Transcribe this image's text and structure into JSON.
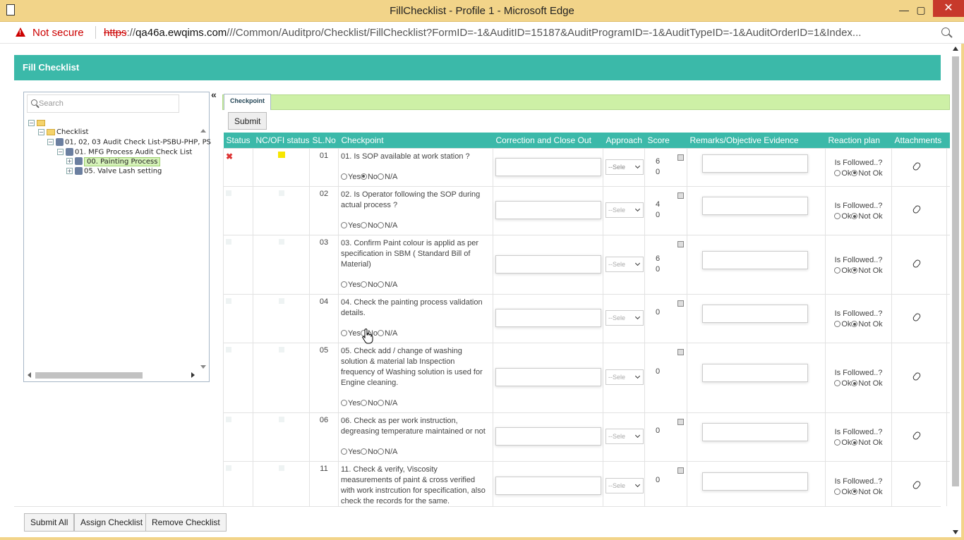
{
  "window": {
    "title": "FillChecklist - Profile 1 - Microsoft Edge"
  },
  "address": {
    "security": "Not secure",
    "scheme": "https",
    "host": "qa46a.ewqims.com",
    "path": "///Common/Auditpro/Checklist/FillChecklist?FormID=-1&AuditID=15187&AuditProgramID=-1&AuditTypeID=-1&AuditOrderID=1&Index..."
  },
  "page": {
    "header": "Fill Checklist",
    "search_placeholder": "Search",
    "collapse_glyph": "«"
  },
  "tree": {
    "root": "Checklist",
    "level1": "01, 02, 03 Audit Check List-PSBU-PHP, PS",
    "level2": "01. MFG Process Audit Check List",
    "level3a": "00. Painting Process",
    "level3b": "05. Valve Lash setting"
  },
  "tabs": {
    "checkpoint": "Checkpoint"
  },
  "toolbar": {
    "submit": "Submit"
  },
  "columns": {
    "status": "Status",
    "ncofi": "NC/OFI status",
    "slno": "SL.No",
    "checkpoint": "Checkpoint",
    "correction": "Correction and Close Out",
    "approach": "Approach",
    "score": "Score",
    "remarks": "Remarks/Objective Evidence",
    "reaction": "Reaction plan",
    "attachments": "Attachments"
  },
  "labels": {
    "yes": "Yes",
    "no": "No",
    "na": "N/A",
    "select": "--Sele",
    "followed": "Is Followed..?",
    "ok": "Ok",
    "notok": "Not Ok",
    "status_x": "✖"
  },
  "rows": [
    {
      "sl": "01",
      "text": "01. Is SOP available at work station ?",
      "score1": "6",
      "score2": "0",
      "answer": "No"
    },
    {
      "sl": "02",
      "text": "02. Is Operator following the SOP during actual process ?",
      "score1": "4",
      "score2": "0",
      "answer": ""
    },
    {
      "sl": "03",
      "text": "03. Confirm Paint colour is applid as per specification in SBM ( Standard Bill of Material)",
      "score1": "6",
      "score2": "0",
      "answer": ""
    },
    {
      "sl": "04",
      "text": "04. Check the painting process validation details.",
      "score1": "0",
      "score2": "",
      "answer": ""
    },
    {
      "sl": "05",
      "text": "05. Check add / change of washing solution & material lab Inspection frequency of Washing solution is used for Engine cleaning.",
      "score1": "0",
      "score2": "",
      "answer": ""
    },
    {
      "sl": "06",
      "text": "06. Check as per work instruction, degreasing temperature maintained or not",
      "score1": "0",
      "score2": "",
      "answer": ""
    },
    {
      "sl": "11",
      "text": "11. Check & verify, Viscosity measurements of paint & cross verified with work instrcution for specification, also check the records for the same.",
      "score1": "0",
      "score2": "",
      "answer": ""
    }
  ],
  "footer": {
    "submit_all": "Submit All",
    "assign": "Assign Checklist",
    "remove": "Remove Checklist"
  }
}
